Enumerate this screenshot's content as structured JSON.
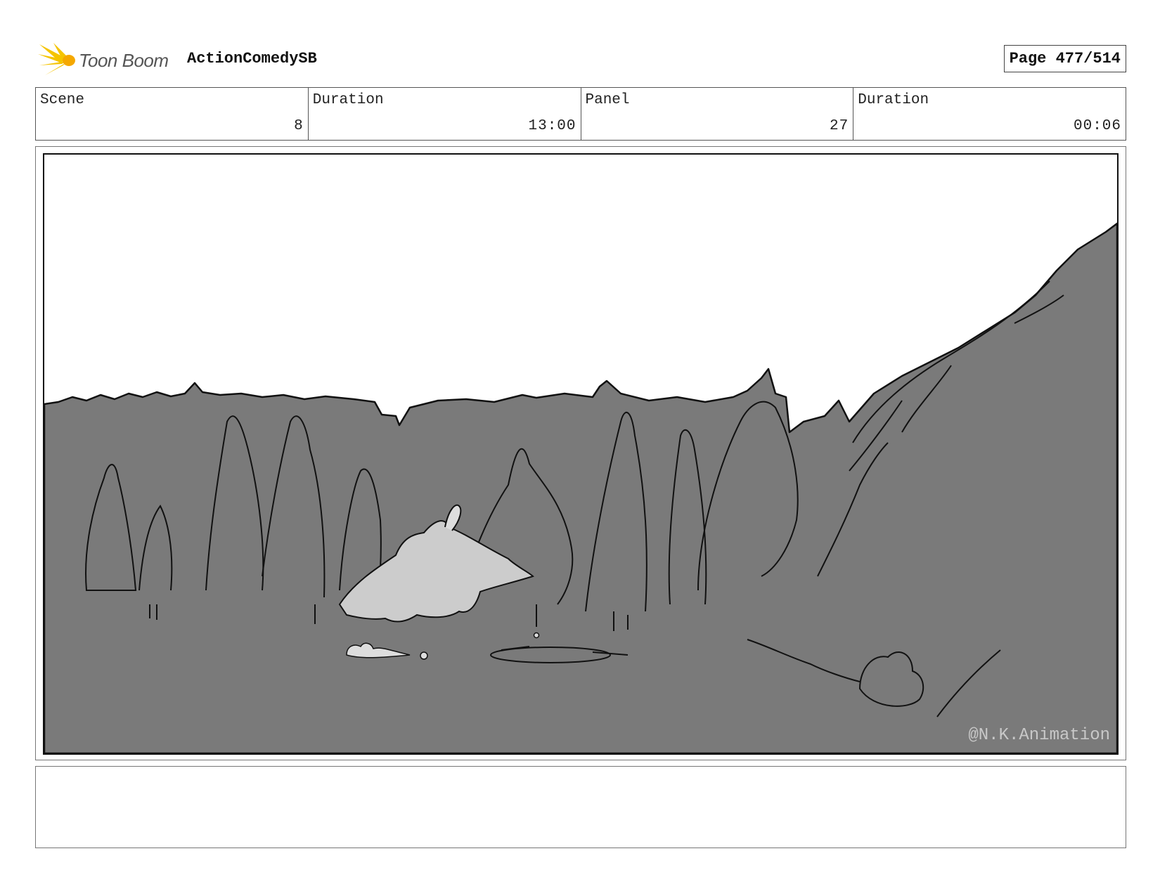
{
  "header": {
    "brand": "Toon Boom",
    "project": "ActionComedySB",
    "page": "Page 477/514"
  },
  "info": [
    {
      "label": "Scene",
      "value": "8"
    },
    {
      "label": "Duration",
      "value": "13:00"
    },
    {
      "label": "Panel",
      "value": "27"
    },
    {
      "label": "Duration",
      "value": "00:06"
    }
  ],
  "panel": {
    "watermark": "@N.K.Animation",
    "colors": {
      "ground": "#7a7a7a",
      "creature": "#cccccc",
      "line": "#111111"
    }
  },
  "notes": {
    "text": ""
  }
}
